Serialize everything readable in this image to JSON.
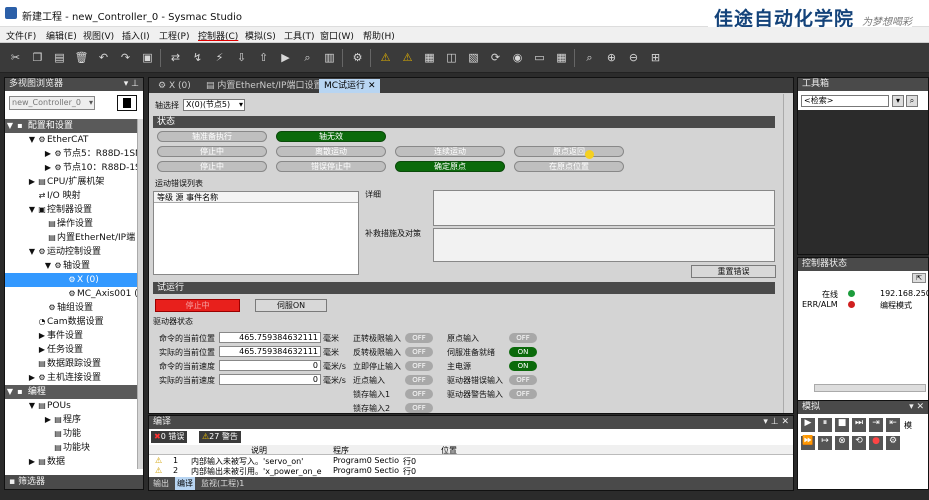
{
  "window": {
    "title": "新建工程 - new_Controller_0 - Sysmac Studio"
  },
  "brand": {
    "text": "佳途自动化学院",
    "sig": "为梦想喝彩"
  },
  "menu": [
    "文件(F)",
    "编辑(E)",
    "视图(V)",
    "插入(I)",
    "工程(P)",
    "控制器(C)",
    "模拟(S)",
    "工具(T)",
    "窗口(W)",
    "帮助(H)"
  ],
  "left": {
    "title": "多视图浏览器",
    "controller": "new_Controller_0",
    "tree": [
      "配置和设置",
      "EtherCAT",
      "节点5：R88D-1SN",
      "节点10：R88D-1S",
      "CPU/扩展机架",
      "I/O 映射",
      "控制器设置",
      "操作设置",
      "内置EtherNet/IP端",
      "运动控制设置",
      "轴设置",
      "X (0)",
      "MC_Axis001 (",
      "轴组设置",
      "Cam数据设置",
      "事件设置",
      "任务设置",
      "数据跟踪设置",
      "主机连接设置",
      "编程",
      "POUs",
      "程序",
      "功能",
      "功能块",
      "数据"
    ],
    "filter": "筛选器"
  },
  "tabs": [
    "X (0)",
    "内置EtherNet/IP端口设置",
    "MC试运行"
  ],
  "axis": {
    "label": "轴选择",
    "value": "X(0)(节点5)"
  },
  "status": {
    "header": "状态",
    "pills": [
      "轴准备执行",
      "轴无效",
      "停止中",
      "离散运动",
      "连续运动",
      "原点返回",
      "停止中",
      "错误停止中",
      "确定原点",
      "在原点位置"
    ],
    "errlist": "运动错误列表",
    "cols": "等级 源 事件名称",
    "detail": "详细",
    "remedy": "补救措施及对策",
    "reset": "重置错误"
  },
  "trial": {
    "header": "试运行",
    "stop": "停止中",
    "servo": "伺服ON",
    "driver": "驱动器状态",
    "rows": [
      {
        "label": "命令的当前位置",
        "value": "465.759384632111",
        "unit": "毫米"
      },
      {
        "label": "实际的当前位置",
        "value": "465.759384632111",
        "unit": "毫米"
      },
      {
        "label": "命令的当前速度",
        "value": "0",
        "unit": "毫米/s"
      },
      {
        "label": "实际的当前速度",
        "value": "0",
        "unit": "毫米/s"
      }
    ],
    "io1": [
      [
        "正转极限输入",
        "OFF"
      ],
      [
        "反转极限输入",
        "OFF"
      ],
      [
        "立即停止输入",
        "OFF"
      ],
      [
        "近点输入",
        "OFF"
      ],
      [
        "锁存输入1",
        "OFF"
      ],
      [
        "锁存输入2",
        "OFF"
      ]
    ],
    "io2": [
      [
        "原点输入",
        "OFF"
      ],
      [
        "伺服准备就绪",
        "ON"
      ],
      [
        "主电源",
        "ON"
      ],
      [
        "驱动器错误输入",
        "OFF"
      ],
      [
        "驱动器警告输入",
        "OFF"
      ]
    ]
  },
  "build": {
    "title": "编译",
    "errors": "0 错误",
    "warnings": "27 警告",
    "cols": [
      "说明",
      "程序",
      "位置"
    ],
    "rows": [
      {
        "n": "1",
        "desc": "内部输入未被写入。'servo_on'",
        "prog": "Program0 Sectio",
        "pos": "行0"
      },
      {
        "n": "2",
        "desc": "内部输出未被引用。'x_power_on_e",
        "prog": "Program0 Sectio",
        "pos": "行0"
      }
    ],
    "tabs": [
      "输出",
      "编译",
      "监视(工程)1"
    ]
  },
  "right": {
    "toolbox": "工具箱",
    "search": "<检索>",
    "ctrlstatus": "控制器状态",
    "online": "在线",
    "ip": "192.168.250.",
    "erralm": "ERR/ALM",
    "mode": "编程模式",
    "sim": "模拟",
    "sim_extra": "模"
  }
}
